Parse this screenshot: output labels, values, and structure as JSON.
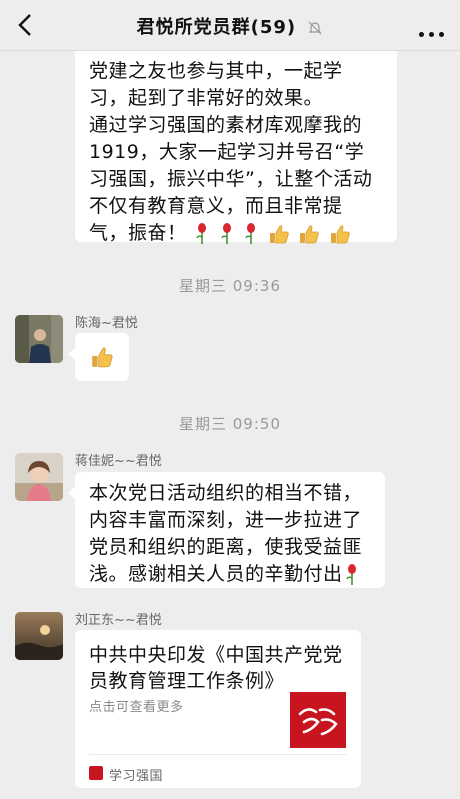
{
  "header": {
    "title": "君悦所党员群(59)"
  },
  "messages": {
    "m1": {
      "lines": [
        "党建之友也参与其中，一起学",
        "习，起到了非常好的效果。",
        "通过学习强国的素材库观摩我的",
        "1919，大家一起学习并号召“学",
        "习强国，振兴中华”，让整个活动",
        "不仅有教育意义，而且非常提",
        "气，振奋！"
      ]
    },
    "t1": "星期三 09:36",
    "m2": {
      "sender": "陈海~君悦"
    },
    "t2": "星期三 09:50",
    "m3": {
      "sender": "蒋佳妮~~君悦",
      "lines": [
        "本次党日活动组织的相当不错，",
        "内容丰富而深刻，进一步拉进了",
        "党员和组织的距离，使我受益匪",
        "浅。感谢相关人员的辛勤付出"
      ]
    },
    "m4": {
      "sender": "刘正东~~君悦",
      "card_title": "中共中央印发《中国共产党党员教育管理工作条例》",
      "card_desc": "点击可查看更多",
      "card_source": "学习强国"
    }
  },
  "icons": {
    "back": "chevron-left-icon",
    "mute": "bell-muted-icon",
    "more": "more-dots-icon",
    "rose": "rose-emoji",
    "thumb": "thumbs-up-emoji"
  },
  "colors": {
    "background": "#ededed",
    "bubble": "#ffffff",
    "brand_red": "#c8141e"
  }
}
